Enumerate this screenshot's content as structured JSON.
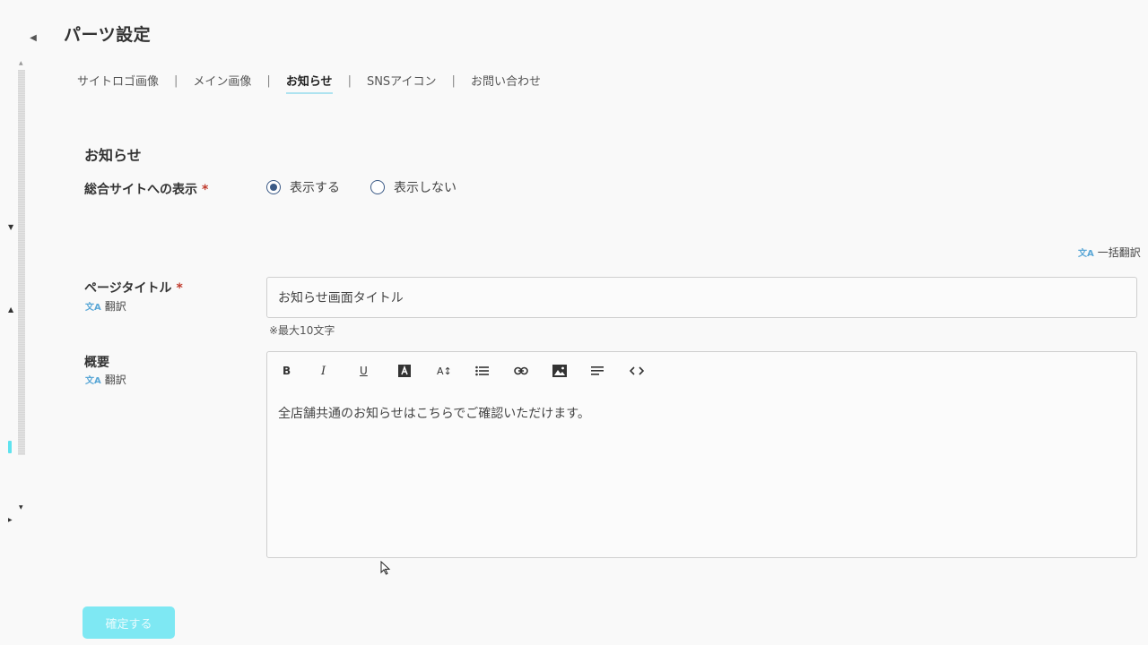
{
  "header": {
    "back_icon": "chevron-left-icon",
    "title": "パーツ設定"
  },
  "tabs": [
    {
      "label": "サイトロゴ画像",
      "active": false
    },
    {
      "label": "メイン画像",
      "active": false
    },
    {
      "label": "お知らせ",
      "active": true
    },
    {
      "label": "SNSアイコン",
      "active": false
    },
    {
      "label": "お問い合わせ",
      "active": false
    }
  ],
  "tab_separator": "|",
  "section": {
    "title": "お知らせ"
  },
  "display_setting": {
    "label": "総合サイトへの表示",
    "required_mark": "*",
    "options": [
      {
        "label": "表示する",
        "selected": true
      },
      {
        "label": "表示しない",
        "selected": false
      }
    ]
  },
  "bulk_translate": {
    "label": "一括翻訳",
    "icon": "translate-icon"
  },
  "page_title": {
    "label": "ページタイトル",
    "required_mark": "*",
    "translate_label": "翻訳",
    "value": "お知らせ画面タイトル",
    "hint": "※最大10文字"
  },
  "summary": {
    "label": "概要",
    "translate_label": "翻訳",
    "toolbar": {
      "bold": "B",
      "italic": "I",
      "underline": "U",
      "font_size": "A↕"
    },
    "content": "全店舗共通のお知らせはこちらでご確認いただけます。"
  },
  "confirm_button": {
    "label": "確定する"
  },
  "colors": {
    "accent": "#7ee8f3",
    "radio": "#3b5a86",
    "required": "#c0392b",
    "tab_underline": "#aee3f0"
  }
}
